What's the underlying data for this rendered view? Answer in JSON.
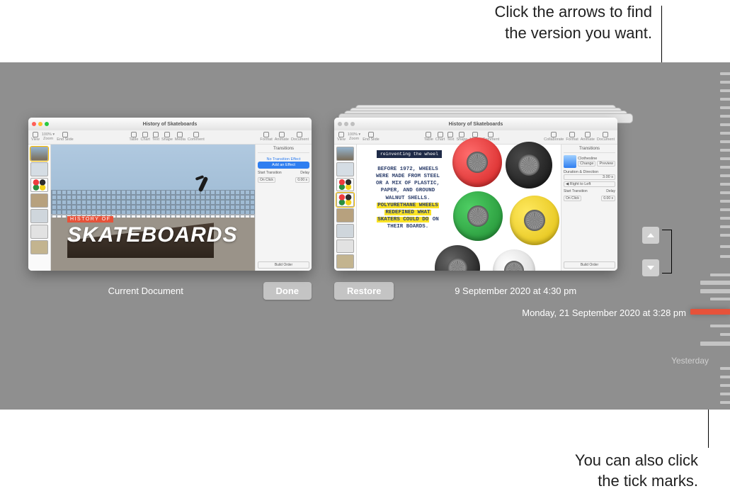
{
  "callouts": {
    "top_l1": "Click the arrows to find",
    "top_l2": "the version you want.",
    "bot_l1": "You can also click",
    "bot_l2": "the tick marks."
  },
  "controls": {
    "current_label": "Current Document",
    "done_label": "Done",
    "restore_label": "Restore",
    "version_date": "9 September 2020  at 4:30 pm",
    "selected_timestamp": "Monday, 21 September 2020  at 3:28 pm",
    "timeline_section_label": "Yesterday"
  },
  "left_window": {
    "title": "History of Skateboards",
    "toolbar": [
      "View",
      "100% ▾",
      "Zoom",
      "End Slide",
      "Table",
      "Chart",
      "Text",
      "Shape",
      "Media",
      "Comment",
      "Format",
      "Animate",
      "Document"
    ],
    "inspector": {
      "tab": "Transitions",
      "effect_status": "No Transition Effect",
      "add_effect": "Add an Effect",
      "start_label": "Start Transition",
      "delay_label": "Delay",
      "start_value": "On Click",
      "delay_value": "0.00 s",
      "build_order": "Build Order"
    },
    "slide": {
      "subheading": "HISTORY OF",
      "title": "SKATEBOARDS"
    }
  },
  "right_window": {
    "title": "History of Skateboards",
    "toolbar": [
      "View",
      "100% ▾",
      "Zoom",
      "End Slide",
      "Table",
      "Chart",
      "Text",
      "Shape",
      "Media",
      "Comment",
      "Collaborate",
      "Format",
      "Animate",
      "Document"
    ],
    "inspector": {
      "tab": "Transitions",
      "effect_name": "Clothesline",
      "change": "Change",
      "preview": "Preview",
      "dur_label": "Duration & Direction",
      "dur_value": "3.00 s",
      "direction": "Right to Left",
      "start_label": "Start Transition",
      "delay_label": "Delay",
      "start_value": "On Click",
      "delay_value": "0.00 s",
      "build_order": "Build Order"
    },
    "slide": {
      "chip": "reinventing the wheel",
      "t1": "BEFORE 1972, WHEELS",
      "t2": "WERE MADE FROM STEEL",
      "t3": "OR A MIX OF PLASTIC,",
      "t4": "PAPER, AND GROUND",
      "t5": "WALNUT SHELLS.",
      "t6": "POLYURETHANE WHEELS",
      "t7": "REDEFINED WHAT",
      "t8": "SKATERS COULD DO",
      "t9": " ON",
      "t10": "THEIR BOARDS."
    }
  }
}
